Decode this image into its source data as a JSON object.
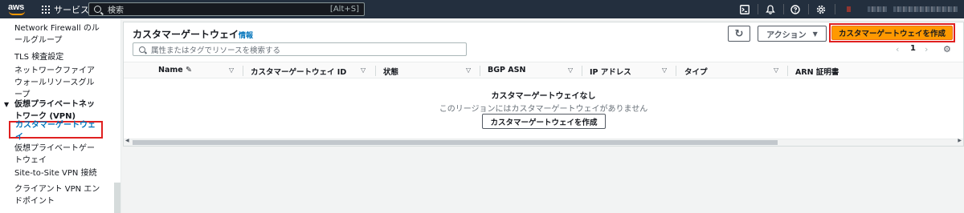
{
  "topnav": {
    "logo_text": "aws",
    "services_label": "サービス",
    "search_placeholder": "検索",
    "search_shortcut": "[Alt+S]",
    "icons": [
      "cloudshell-icon",
      "notifications-icon",
      "help-icon",
      "settings-icon"
    ]
  },
  "sidebar": {
    "items": [
      {
        "label": "Network Firewall のルールグループ"
      },
      {
        "label": "TLS 検査設定"
      },
      {
        "label": "ネットワークファイアウォールリソースグループ"
      },
      {
        "label": "仮想プライベートネットワーク (VPN)"
      },
      {
        "label": "カスタマーゲートウェイ"
      },
      {
        "label": "仮想プライベートゲートウェイ"
      },
      {
        "label": "Site-to-Site VPN 接続"
      },
      {
        "label": "クライアント VPN エンドポイント"
      }
    ],
    "group_caret": "▼"
  },
  "main": {
    "title": "カスタマーゲートウェイ",
    "info_label": "情報",
    "refresh_icon": "↻",
    "actions_label": "アクション",
    "actions_caret": "▼",
    "create_label": "カスタマーゲートウェイを作成",
    "filter_placeholder": "属性またはタグでリソースを検索する",
    "pager": {
      "prev": "‹",
      "page": "1",
      "next": "›",
      "settings": "⚙"
    },
    "columns": [
      {
        "label": "Name",
        "edit_icon": "✎"
      },
      {
        "label": "カスタマーゲートウェイ ID"
      },
      {
        "label": "状態"
      },
      {
        "label": "BGP ASN"
      },
      {
        "label": "IP アドレス"
      },
      {
        "label": "タイプ"
      },
      {
        "label": "ARN 証明書"
      }
    ],
    "sort_icon": "▽",
    "empty_title": "カスタマーゲートウェイなし",
    "empty_desc": "このリージョンにはカスタマーゲートウェイがありません",
    "empty_button": "カスタマーゲートウェイを作成"
  },
  "colors": {
    "nav_bg": "#232f3e",
    "accent_orange": "#ff9900",
    "link_blue": "#0073bb",
    "highlight_red": "#e02020"
  }
}
